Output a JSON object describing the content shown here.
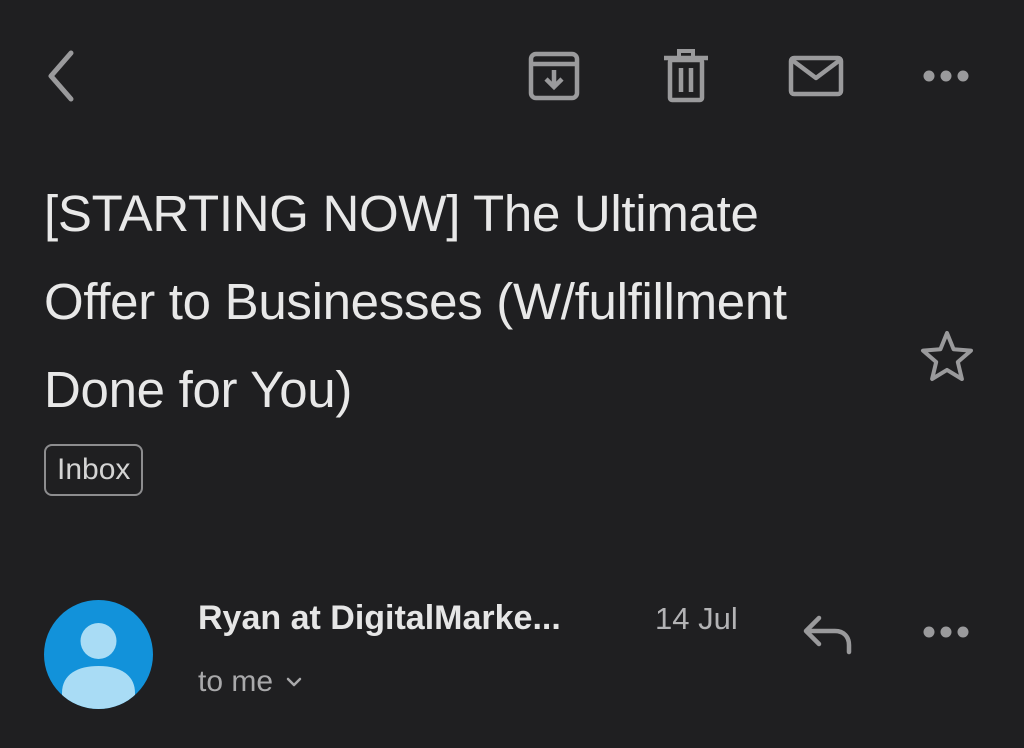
{
  "toolbar": {
    "back_icon": "chevron-left-icon",
    "archive_icon": "archive-icon",
    "delete_icon": "trash-icon",
    "mark_unread_icon": "mail-icon",
    "more_icon": "more-horizontal-icon"
  },
  "email": {
    "subject": "[STARTING NOW] The Ultimate Offer to Businesses (W/fulfillment Done for You)",
    "label": "Inbox",
    "starred": false,
    "message": {
      "sender": "Ryan at DigitalMarke...",
      "date": "14 Jul",
      "recipient": "to me"
    }
  },
  "colors": {
    "background": "#1f1f21",
    "icon": "#9a9a9c",
    "avatar": "#1292da",
    "avatar_figure": "#a9dcf5"
  }
}
